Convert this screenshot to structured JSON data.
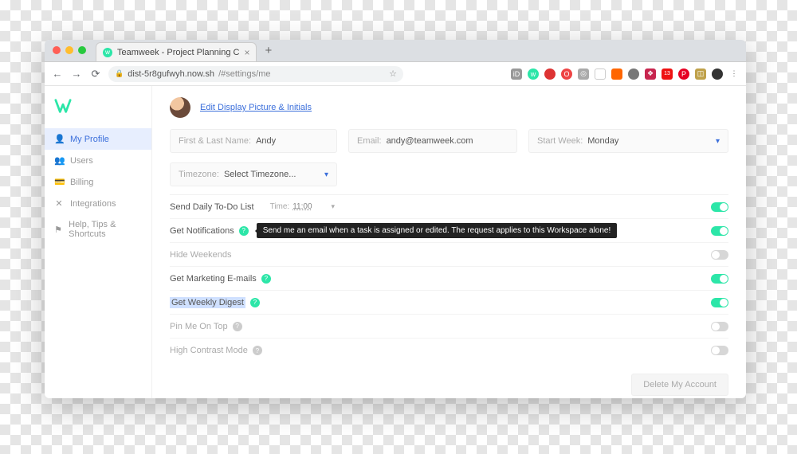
{
  "browser": {
    "tab_title": "Teamweek - Project Planning C",
    "url_host": "dist-5r8gufwyh.now.sh",
    "url_path": "/#settings/me"
  },
  "sidebar": {
    "items": [
      {
        "label": "My Profile",
        "icon": "person"
      },
      {
        "label": "Users",
        "icon": "users"
      },
      {
        "label": "Billing",
        "icon": "card"
      },
      {
        "label": "Integrations",
        "icon": "cross-tool"
      },
      {
        "label": "Help, Tips & Shortcuts",
        "icon": "flag"
      }
    ]
  },
  "profile": {
    "edit_link": "Edit Display Picture & Initials",
    "name_label": "First & Last Name:",
    "name_value": "Andy",
    "email_label": "Email:",
    "email_value": "andy@teamweek.com",
    "startweek_label": "Start Week:",
    "startweek_value": "Monday",
    "timezone_label": "Timezone:",
    "timezone_value": "Select Timezone..."
  },
  "settings": {
    "daily": {
      "label": "Send Daily To-Do List",
      "time_label": "Time:",
      "time_value": "11:00",
      "on": true
    },
    "notifications": {
      "label": "Get Notifications",
      "tooltip": "Send me an email when a task is assigned or edited. The request applies to this Workspace alone!",
      "on": true
    },
    "hideweekends": {
      "label": "Hide Weekends",
      "on": false
    },
    "marketing": {
      "label": "Get Marketing E-mails",
      "on": true
    },
    "weeklydigest": {
      "label": "Get Weekly Digest",
      "on": true
    },
    "pinme": {
      "label": "Pin Me On Top",
      "on": false
    },
    "contrast": {
      "label": "High Contrast Mode",
      "on": false
    }
  },
  "footer": {
    "delete_label": "Delete My Account"
  }
}
